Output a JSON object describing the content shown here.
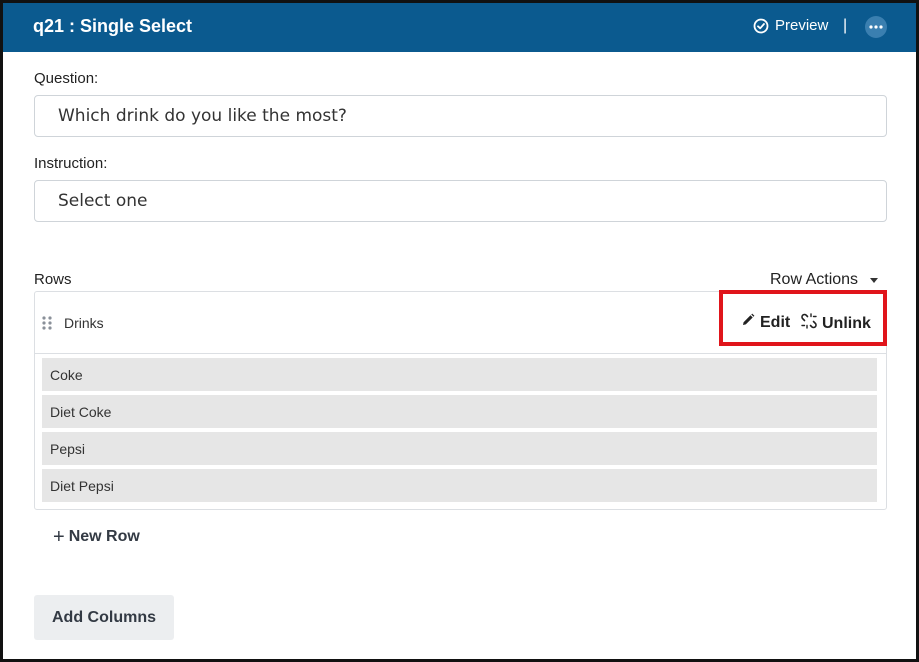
{
  "header": {
    "title": "q21 : Single Select",
    "preview_label": "Preview",
    "separator": "|",
    "more_icon": "ellipsis-icon",
    "background_color": "#0b5a8f"
  },
  "question": {
    "label": "Question:",
    "value": "Which drink do you like the most?"
  },
  "instruction": {
    "label": "Instruction:",
    "value": "Select one"
  },
  "rows": {
    "label": "Rows",
    "row_actions_label": "Row Actions",
    "group": {
      "name": "Drinks",
      "edit_label": "Edit",
      "unlink_label": "Unlink",
      "items": [
        "Coke",
        "Diet Coke",
        "Pepsi",
        "Diet Pepsi"
      ]
    },
    "new_row_label": "New Row"
  },
  "add_columns_label": "Add Columns",
  "highlight_color": "#e0151b"
}
